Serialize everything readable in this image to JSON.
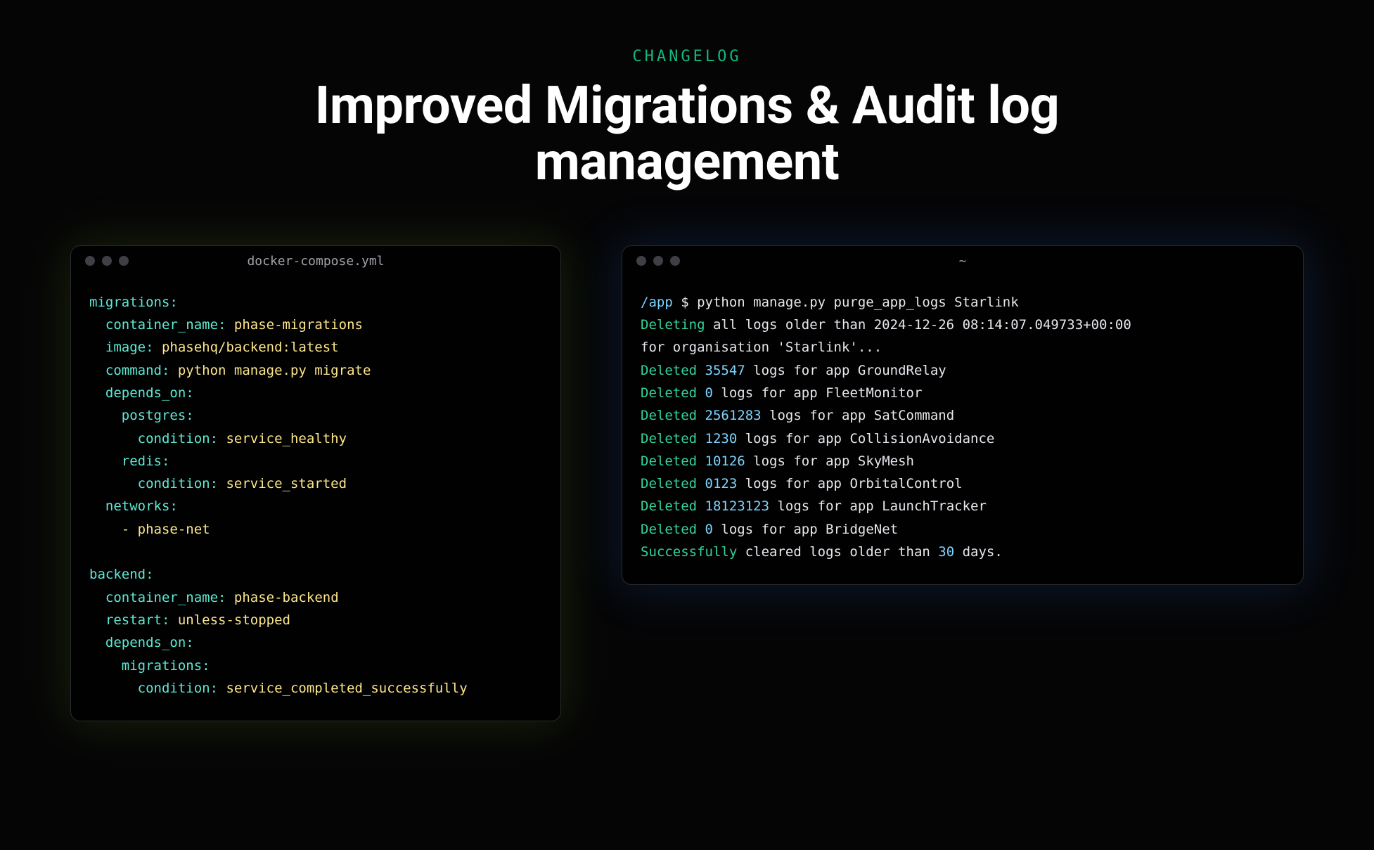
{
  "header": {
    "eyebrow": "CHANGELOG",
    "title_line1": "Improved Migrations & Audit log",
    "title_line2": "management"
  },
  "yaml_window": {
    "title": "docker-compose.yml",
    "keys": {
      "migrations": "migrations:",
      "container_name": "container_name:",
      "image": "image:",
      "command": "command:",
      "depends_on": "depends_on:",
      "postgres": "postgres:",
      "condition": "condition:",
      "redis": "redis:",
      "networks": "networks:",
      "backend": "backend:",
      "restart": "restart:",
      "migrations_dep": "migrations:"
    },
    "values": {
      "phase_migrations": " phase-migrations",
      "phase_backend_image": " phasehq/backend:latest",
      "migrate_cmd": " python manage.py migrate",
      "service_healthy": " service_healthy",
      "service_started": " service_started",
      "phase_net": "- phase-net",
      "phase_backend": " phase-backend",
      "unless_stopped": " unless-stopped",
      "service_completed": " service_completed_successfully"
    }
  },
  "term_window": {
    "title": "~",
    "prompt_path": "/app",
    "prompt_symbol": " $ ",
    "command": "python manage.py purge_app_logs Starlink",
    "deleting_word": "Deleting",
    "deleting_rest": " all logs older than 2024-12-26 08:14:07.049733+00:00",
    "for_org": "for organisation 'Starlink'...",
    "deleted_word": "Deleted ",
    "logs_for_app": " logs for app ",
    "entries": [
      {
        "count": "35547",
        "app": "GroundRelay"
      },
      {
        "count": "0",
        "app": "FleetMonitor"
      },
      {
        "count": "2561283",
        "app": "SatCommand"
      },
      {
        "count": "1230",
        "app": "CollisionAvoidance"
      },
      {
        "count": "10126",
        "app": "SkyMesh"
      },
      {
        "count": "0123",
        "app": "OrbitalControl"
      },
      {
        "count": "18123123",
        "app": "LaunchTracker"
      },
      {
        "count": "0",
        "app": "BridgeNet"
      }
    ],
    "success_word": "Successfully",
    "success_mid": " cleared logs older than ",
    "success_days": "30",
    "success_end": " days."
  }
}
